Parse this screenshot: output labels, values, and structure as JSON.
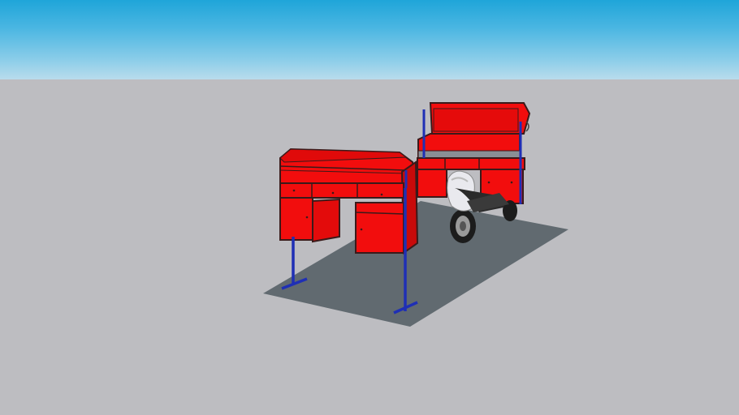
{
  "scene": {
    "sky_color": "#1fa5d9",
    "horizon_color": "#b9dcec",
    "ground_color": "#bdbdc1",
    "floor_color": "#616a70",
    "cabinet_color": "#f20d0d",
    "cabinet_shade_color": "#c80a0a",
    "frame_color": "#1f2fb5",
    "edge_color": "#3a1a1a",
    "objects": [
      "workbench-left",
      "workbench-right",
      "scooter",
      "floor-slab",
      "support-posts"
    ]
  }
}
